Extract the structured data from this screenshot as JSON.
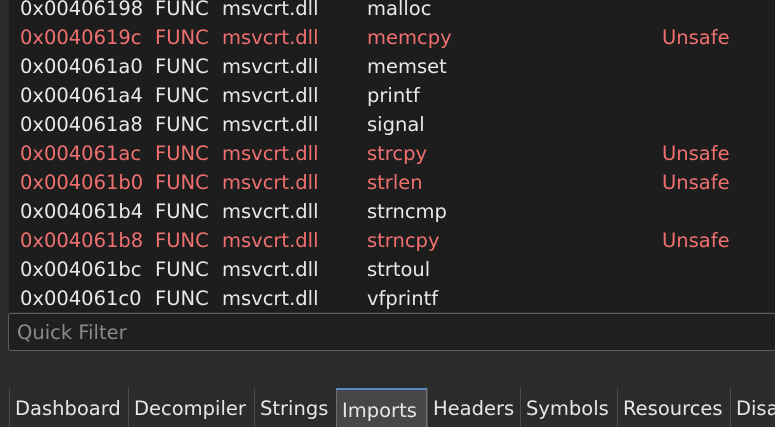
{
  "imports": {
    "rows": [
      {
        "address": "0x00406198",
        "type": "FUNC",
        "library": "msvcrt.dll",
        "name": "malloc",
        "flag": "",
        "unsafe": false
      },
      {
        "address": "0x0040619c",
        "type": "FUNC",
        "library": "msvcrt.dll",
        "name": "memcpy",
        "flag": "Unsafe",
        "unsafe": true
      },
      {
        "address": "0x004061a0",
        "type": "FUNC",
        "library": "msvcrt.dll",
        "name": "memset",
        "flag": "",
        "unsafe": false
      },
      {
        "address": "0x004061a4",
        "type": "FUNC",
        "library": "msvcrt.dll",
        "name": "printf",
        "flag": "",
        "unsafe": false
      },
      {
        "address": "0x004061a8",
        "type": "FUNC",
        "library": "msvcrt.dll",
        "name": "signal",
        "flag": "",
        "unsafe": false
      },
      {
        "address": "0x004061ac",
        "type": "FUNC",
        "library": "msvcrt.dll",
        "name": "strcpy",
        "flag": "Unsafe",
        "unsafe": true
      },
      {
        "address": "0x004061b0",
        "type": "FUNC",
        "library": "msvcrt.dll",
        "name": "strlen",
        "flag": "Unsafe",
        "unsafe": true
      },
      {
        "address": "0x004061b4",
        "type": "FUNC",
        "library": "msvcrt.dll",
        "name": "strncmp",
        "flag": "",
        "unsafe": false
      },
      {
        "address": "0x004061b8",
        "type": "FUNC",
        "library": "msvcrt.dll",
        "name": "strncpy",
        "flag": "Unsafe",
        "unsafe": true
      },
      {
        "address": "0x004061bc",
        "type": "FUNC",
        "library": "msvcrt.dll",
        "name": "strtoul",
        "flag": "",
        "unsafe": false
      },
      {
        "address": "0x004061c0",
        "type": "FUNC",
        "library": "msvcrt.dll",
        "name": "vfprintf",
        "flag": "",
        "unsafe": false
      }
    ]
  },
  "filter": {
    "placeholder": "Quick Filter",
    "value": ""
  },
  "tabs": {
    "items": [
      {
        "label": "Dashboard",
        "active": false
      },
      {
        "label": "Decompiler",
        "active": false
      },
      {
        "label": "Strings",
        "active": false
      },
      {
        "label": "Imports",
        "active": true
      },
      {
        "label": "Headers",
        "active": false
      },
      {
        "label": "Symbols",
        "active": false
      },
      {
        "label": "Resources",
        "active": false
      },
      {
        "label": "Disa",
        "active": false
      }
    ]
  },
  "colors": {
    "list_background": "#1d1d1d",
    "normal_text": "#e8e8e8",
    "unsafe_text": "#f07070",
    "active_tab": "#474747",
    "active_tab_accent": "#5a88c8"
  }
}
